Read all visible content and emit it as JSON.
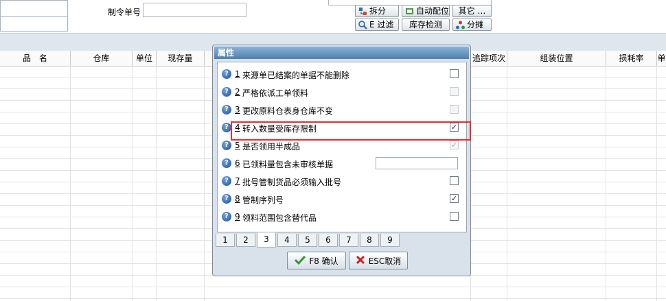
{
  "form": {
    "order_no_label": "制令单号"
  },
  "toolbar": {
    "split": "拆分",
    "auto_alloc": "自动配位",
    "other": "其它 …",
    "filter": "E 过滤",
    "stock_check": "库存检测",
    "apportion": "分摊"
  },
  "grid": {
    "columns": [
      "品　名",
      "仓库",
      "单位",
      "现存量",
      "追踪项次",
      "组装位置",
      "损耗率",
      "单"
    ]
  },
  "dialog": {
    "title": "属性",
    "items": [
      {
        "num": "1",
        "text": "来源单已结案的单据不能删除",
        "control": "checkbox",
        "checked": false,
        "disabled": false
      },
      {
        "num": "2",
        "text": "严格依派工单领料",
        "control": "checkbox",
        "checked": false,
        "disabled": true
      },
      {
        "num": "3",
        "text": "更改原料仓表身仓库不变",
        "control": "checkbox",
        "checked": false,
        "disabled": true
      },
      {
        "num": "4",
        "text": "转入数量受库存限制",
        "control": "checkbox",
        "checked": true,
        "disabled": false
      },
      {
        "num": "5",
        "text": "是否领用半成品",
        "control": "checkbox",
        "checked": true,
        "disabled": true
      },
      {
        "num": "6",
        "text": "已领料量包含未审核单据",
        "control": "textbox",
        "value": ""
      },
      {
        "num": "7",
        "text": "批号管制货品必须输入批号",
        "control": "checkbox",
        "checked": false,
        "disabled": false
      },
      {
        "num": "8",
        "text": "管制序列号",
        "control": "checkbox",
        "checked": true,
        "disabled": false
      },
      {
        "num": "9",
        "text": "领料范围包含替代品",
        "control": "checkbox",
        "checked": false,
        "disabled": false
      }
    ],
    "tabs": [
      "1",
      "2",
      "3",
      "4",
      "5",
      "6",
      "7",
      "8",
      "9"
    ],
    "active_tab": "3",
    "ok_label": "F8 确认",
    "cancel_label": "ESC取消"
  }
}
